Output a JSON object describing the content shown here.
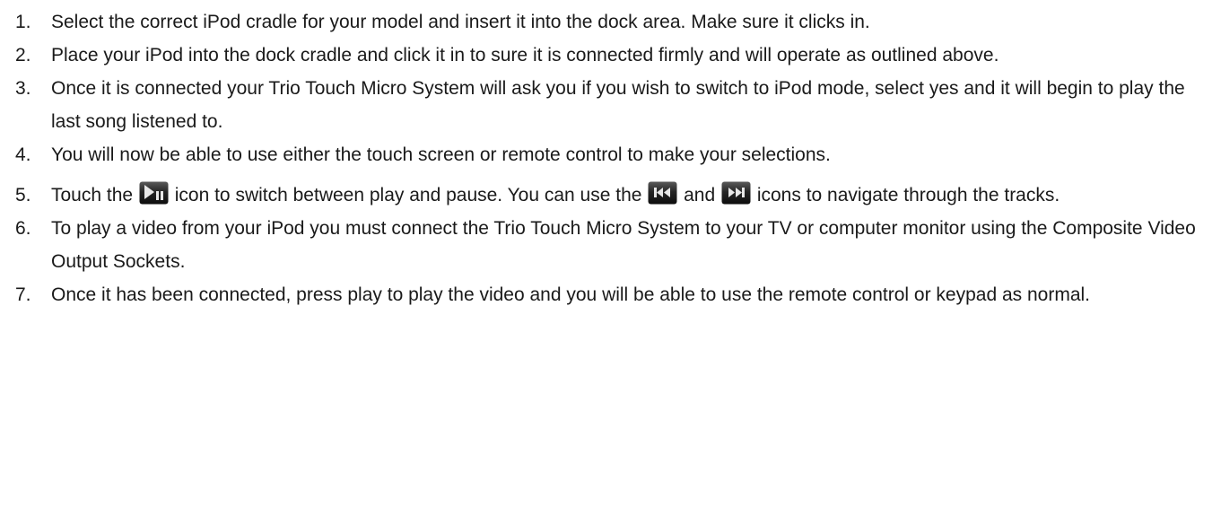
{
  "steps": [
    {
      "number": "1.",
      "text": "Select the correct iPod cradle for your model and insert it into the dock area. Make sure it clicks in."
    },
    {
      "number": "2.",
      "text": "Place your iPod into the dock cradle and click it in to sure it is connected firmly and will operate as outlined above."
    },
    {
      "number": "3.",
      "text": "Once it is connected your Trio Touch Micro System will ask you if you wish to switch to iPod mode, select yes and it will begin to play the last song listened to."
    },
    {
      "number": "4.",
      "text": "You will now be able to use either the touch screen or remote control to make your selections."
    },
    {
      "number": "5.",
      "part1": "Touch the ",
      "icon1": "play-pause-icon",
      "part2": " icon to switch between play and pause. You can use the ",
      "icon2": "previous-track-icon",
      "part3": " and ",
      "icon3": "next-track-icon",
      "part4": " icons to navigate through the tracks."
    },
    {
      "number": "6.",
      "text": "To play a video from your iPod you must connect the Trio Touch Micro System to your TV or computer monitor using the Composite Video Output Sockets."
    },
    {
      "number": "7.",
      "text": "Once it has been connected, press play to play the video and you will be able to use the remote control or keypad as normal."
    }
  ],
  "colors": {
    "text": "#1a1a1a",
    "icon_dark": "#1c1c1c",
    "icon_light": "#e8e8e8"
  }
}
